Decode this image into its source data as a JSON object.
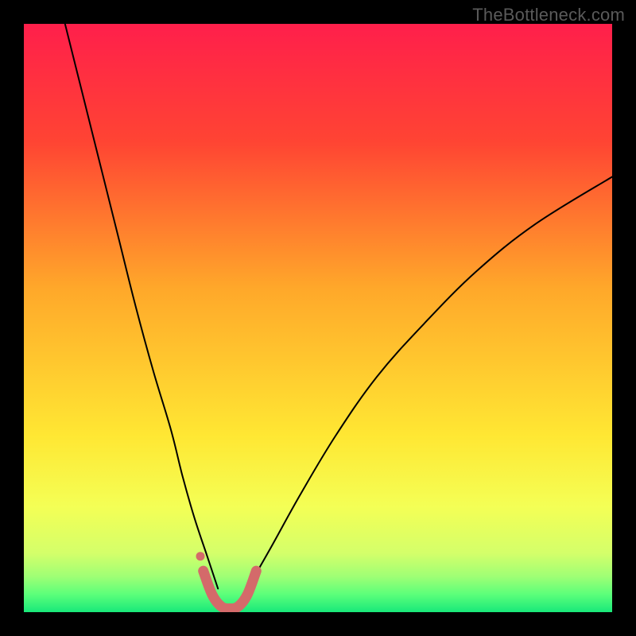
{
  "watermark": "TheBottleneck.com",
  "chart_data": {
    "type": "line",
    "title": "",
    "xlabel": "",
    "ylabel": "",
    "xlim": [
      0,
      100
    ],
    "ylim": [
      0,
      100
    ],
    "grid": false,
    "legend": false,
    "background_gradient": {
      "stops": [
        {
          "pos": 0.0,
          "color": "#ff1f4b"
        },
        {
          "pos": 0.2,
          "color": "#ff4433"
        },
        {
          "pos": 0.45,
          "color": "#ffa82a"
        },
        {
          "pos": 0.7,
          "color": "#ffe733"
        },
        {
          "pos": 0.82,
          "color": "#f4ff55"
        },
        {
          "pos": 0.9,
          "color": "#d4ff6a"
        },
        {
          "pos": 0.94,
          "color": "#9eff75"
        },
        {
          "pos": 0.97,
          "color": "#5bff7a"
        },
        {
          "pos": 1.0,
          "color": "#18e87a"
        }
      ]
    },
    "series": [
      {
        "name": "left-branch",
        "type": "curve",
        "stroke": "#000000",
        "stroke_width": 2,
        "x": [
          7,
          10,
          13,
          16,
          19,
          22,
          25,
          27,
          29,
          31,
          33
        ],
        "y": [
          100,
          88,
          76,
          64,
          52,
          41,
          31,
          23,
          16,
          10,
          4
        ]
      },
      {
        "name": "right-branch",
        "type": "curve",
        "stroke": "#000000",
        "stroke_width": 2,
        "x": [
          38,
          42,
          47,
          53,
          60,
          68,
          77,
          87,
          100
        ],
        "y": [
          4,
          11,
          20,
          30,
          40,
          49,
          58,
          66,
          74
        ]
      },
      {
        "name": "highlight-segment",
        "type": "curve",
        "stroke": "#d46a6a",
        "stroke_width": 13,
        "x": [
          30.5,
          32.0,
          33.5,
          35.0,
          36.5,
          38.0,
          39.5
        ],
        "y": [
          7.0,
          3.0,
          1.0,
          0.6,
          1.0,
          3.0,
          7.0
        ]
      }
    ],
    "markers": [
      {
        "name": "left-dot",
        "x": 30.0,
        "y": 9.5,
        "r": 5.5,
        "color": "#d46a6a"
      }
    ]
  }
}
